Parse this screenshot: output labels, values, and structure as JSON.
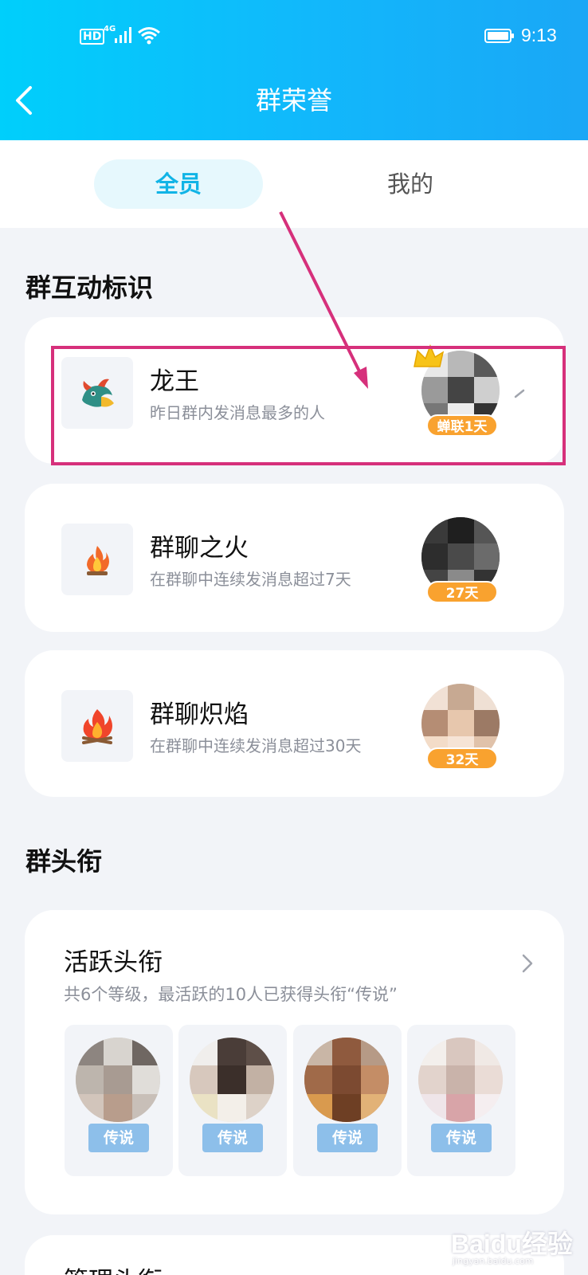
{
  "status_bar": {
    "hd": "HD",
    "network": "4G",
    "time": "9:13"
  },
  "header": {
    "title": "群荣誉"
  },
  "tabs": [
    {
      "label": "全员",
      "active": true
    },
    {
      "label": "我的",
      "active": false
    }
  ],
  "interactive_section": {
    "title": "群互动标识",
    "cards": [
      {
        "name": "龙王",
        "desc": "昨日群内发消息最多的人",
        "badge": "蝉联1天",
        "icon": "dragon-icon"
      },
      {
        "name": "群聊之火",
        "desc": "在群聊中连续发消息超过7天",
        "badge": "27天",
        "icon": "fire-icon"
      },
      {
        "name": "群聊炽焰",
        "desc": "在群聊中连续发消息超过30天",
        "badge": "32天",
        "icon": "campfire-icon"
      }
    ]
  },
  "title_section": {
    "title": "群头衔",
    "card": {
      "title": "活跃头衔",
      "desc": "共6个等级，最活跃的10人已获得头衔“传说”",
      "members": [
        {
          "badge": "传说"
        },
        {
          "badge": "传说"
        },
        {
          "badge": "传说"
        },
        {
          "badge": "传说"
        }
      ]
    },
    "next_card_title": "管理头衔"
  },
  "watermark": {
    "main": "Baidu经验",
    "url": "jingyan.baidu.com"
  },
  "colors": {
    "header_gradient_start": "#00cffb",
    "header_gradient_end": "#1aa7f6",
    "active_tab_text": "#11b4e6",
    "badge_orange": "#f9a22f",
    "title_badge_blue": "#8dbfea",
    "annotation_magenta": "#d6307b"
  }
}
